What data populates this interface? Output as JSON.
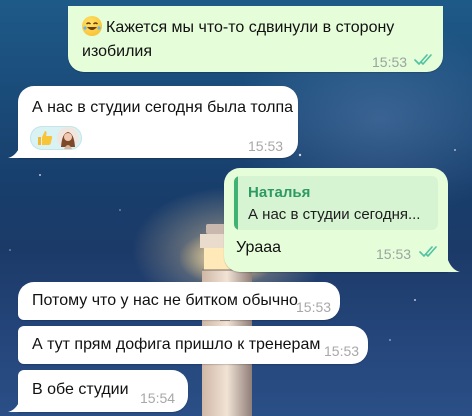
{
  "messages": [
    {
      "direction": "outgoing",
      "line1": "Кажется мы что-то сдвинули в сторону",
      "line2": "изобилия",
      "time": "15:53",
      "read": true,
      "emoji": "laughing-face"
    },
    {
      "direction": "incoming",
      "text": "А нас в студии сегодня была толпа",
      "time": "15:53",
      "reactions": [
        "thumbs-up",
        "avatar"
      ]
    },
    {
      "direction": "outgoing",
      "reply": {
        "author": "Наталья",
        "text": "А нас в студии сегодня..."
      },
      "text": "Урааа",
      "time": "15:53",
      "read": true
    },
    {
      "direction": "incoming",
      "text": "Потому что у нас не битком обычно",
      "time": "15:53"
    },
    {
      "direction": "incoming",
      "text": "А тут прям дофига пришло к тренерам",
      "time": "15:53"
    },
    {
      "direction": "incoming",
      "text": "В обе студии",
      "time": "15:54"
    }
  ],
  "colors": {
    "outgoing_bubble": "#e6fdd9",
    "incoming_bubble": "#ffffff",
    "reply_accent": "#2e9a63",
    "read_check": "#4fc3a1"
  }
}
